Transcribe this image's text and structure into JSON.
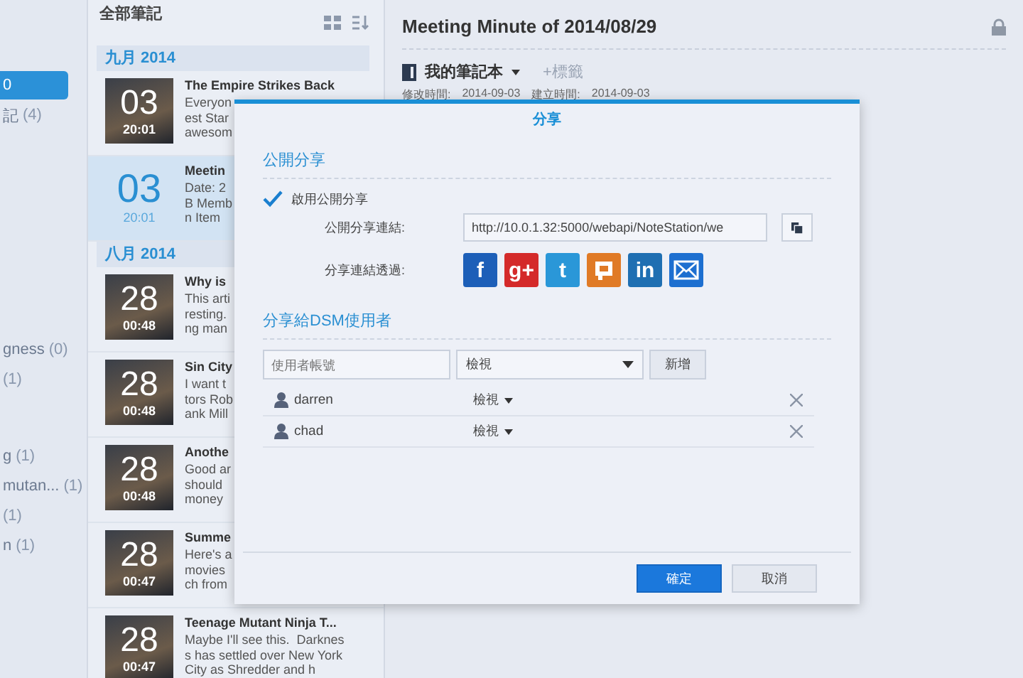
{
  "sidebar": {
    "sections": [
      {
        "items": [
          {
            "count": "0",
            "selected": true
          },
          {
            "label": "記",
            "count": "(4)",
            "selected": false
          }
        ]
      },
      {
        "items": [
          {
            "label": "gness",
            "count": "(0)",
            "selected": false
          },
          {
            "count": "(1)",
            "selected": false
          }
        ]
      },
      {
        "items": [
          {
            "label": "g",
            "count": "(1)",
            "selected": false
          },
          {
            "label": "mutan...",
            "count": "(1)",
            "selected": false
          },
          {
            "count": "(1)",
            "selected": false
          },
          {
            "label": "n",
            "count": "(1)",
            "selected": false
          }
        ]
      }
    ]
  },
  "note_list": {
    "heading": "全部筆記",
    "groups": [
      {
        "month": "九月 2014",
        "notes": [
          {
            "title": "The Empire Strikes Back",
            "lines": [
              "Everyon",
              "est Star",
              "awesom"
            ],
            "day": "03",
            "time": "20:01",
            "selected": false
          },
          {
            "title": "Meetin",
            "lines": [
              "Date: 2",
              "B Memb",
              "n Item"
            ],
            "day": "03",
            "time": "20:01",
            "selected": true
          }
        ]
      },
      {
        "month": "八月 2014",
        "notes": [
          {
            "title": "Why is",
            "lines": [
              "This arti",
              "resting.",
              "ng man"
            ],
            "day": "28",
            "time": "00:48",
            "selected": false
          },
          {
            "title": "Sin City",
            "lines": [
              "I want t",
              "tors Rob",
              "ank Mill"
            ],
            "day": "28",
            "time": "00:48",
            "selected": false
          },
          {
            "title": "Anothe",
            "lines": [
              "Good ar",
              "should",
              "money"
            ],
            "day": "28",
            "time": "00:48",
            "selected": false
          },
          {
            "title": "Summe",
            "lines": [
              "Here's a",
              "movies",
              "ch from"
            ],
            "day": "28",
            "time": "00:47",
            "selected": false
          },
          {
            "title": "Teenage Mutant Ninja T...",
            "lines": [
              "Maybe I'll see this.  Darknes",
              "s has settled over New York",
              "City as Shredder and h"
            ],
            "day": "28",
            "time": "00:47",
            "selected": false
          }
        ]
      }
    ]
  },
  "note": {
    "title": "Meeting Minute of 2014/08/29",
    "notebook": "我的筆記本",
    "add_tag": "+標籤",
    "modified_label": "修改時間:",
    "modified": "2014-09-03",
    "created_label": "建立時間:",
    "created": "2014-09-03"
  },
  "dialog": {
    "title": "分享",
    "public_heading": "公開分享",
    "enable_label": "啟用公開分享",
    "enabled": true,
    "link_label": "公開分享連結:",
    "link": "http://10.0.1.32:5000/webapi/NoteStation/we",
    "via_label": "分享連結透過:",
    "share_via": [
      {
        "kind": "letter",
        "text": "f",
        "color": "#1d5fb8"
      },
      {
        "kind": "letter",
        "text": "g+",
        "color": "#d42a2a"
      },
      {
        "kind": "letter",
        "text": "t",
        "color": "#2a97d8"
      },
      {
        "kind": "frame",
        "color": "#e07a26"
      },
      {
        "kind": "letter",
        "text": "in",
        "color": "#1f6fb2"
      },
      {
        "kind": "envelope",
        "color": "#1d6fd0"
      }
    ],
    "users_heading": "分享給DSM使用者",
    "user_placeholder": "使用者帳號",
    "permission": "檢視",
    "add": "新增",
    "users": [
      {
        "name": "darren",
        "permission": "檢視"
      },
      {
        "name": "chad",
        "permission": "檢視"
      }
    ],
    "ok": "確定",
    "cancel": "取消"
  }
}
